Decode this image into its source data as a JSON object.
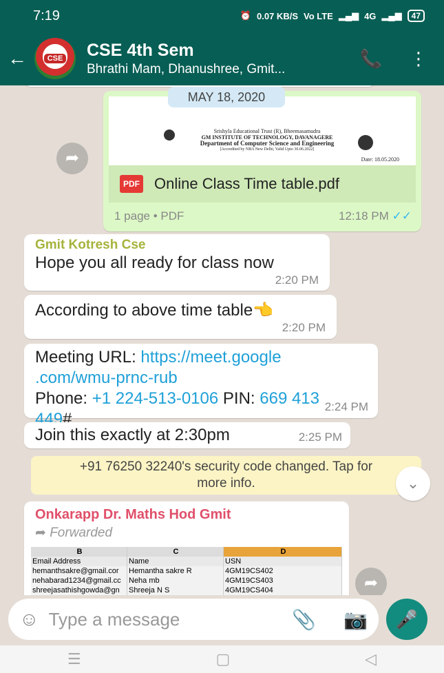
{
  "status_bar": {
    "time": "7:19",
    "network_speed": "0.07 KB/S",
    "volte": "Vo LTE",
    "signal": "4G",
    "battery": "47"
  },
  "header": {
    "title": "CSE 4th Sem",
    "subtitle": "Bhrathi Mam, Dhanushree, Gmit...",
    "avatar_text": "CSE"
  },
  "date_chip": "MAY 18, 2020",
  "doc_message": {
    "preview_lines": [
      "Srishyla Educational Trust (R), Bheemasamudra",
      "GM INSTITUTE OF TECHNOLOGY, DAVANAGERE",
      "Department of Computer Science and Engineering",
      "[Accredited by NBA New Delhi, Valid Upto 30.06.2022]",
      "Date: 18.05.2020"
    ],
    "file_name": "Online Class Time table.pdf",
    "file_icon": "PDF",
    "meta": "1 page • PDF",
    "time": "12:18 PM",
    "ticks": "✓✓"
  },
  "messages": [
    {
      "sender": "Gmit Kotresh Cse",
      "text": "Hope you all ready for class now",
      "time": "2:20 PM"
    },
    {
      "text": "According to above time table👈",
      "time": "2:20 PM"
    },
    {
      "prefix": "Meeting URL: ",
      "url1": "https://meet.google",
      "url2": ".com/wmu-prnc-rub",
      "phone_label": "Phone: ",
      "phone": "+1 224-513-0106",
      "pin_label": " PIN: ",
      "pin1": "669 413",
      "pin2": "449",
      "pin_suffix": "#",
      "time": "2:24 PM"
    },
    {
      "text": "Join this exactly at 2:30pm",
      "time": "2:25 PM"
    }
  ],
  "system_message": {
    "line1": "+91 76250 32240's security code changed. Tap for",
    "line2": "more info."
  },
  "forwarded_message": {
    "sender": "Onkarapp Dr. Maths Hod Gmit",
    "forwarded_label": "Forwarded",
    "sheet": {
      "columns": [
        "B",
        "C",
        "D"
      ],
      "headers": [
        "Email Address",
        "Name",
        "USN"
      ],
      "rows": [
        [
          "hemanthsakre@gmail.cor",
          "Hemantha sakre R",
          "4GM19CS402"
        ],
        [
          "nehabarad1234@gmail.cc",
          "Neha mb",
          "4GM19CS403"
        ],
        [
          "shreejasathishgowda@gn",
          "Shreeja N S",
          "4GM19CS404"
        ]
      ]
    }
  },
  "composer": {
    "placeholder": "Type a message"
  },
  "colors": {
    "header": "#075e54",
    "accent": "#128c7e",
    "outgoing": "#dcf8c6",
    "background": "#e5ddd5"
  }
}
